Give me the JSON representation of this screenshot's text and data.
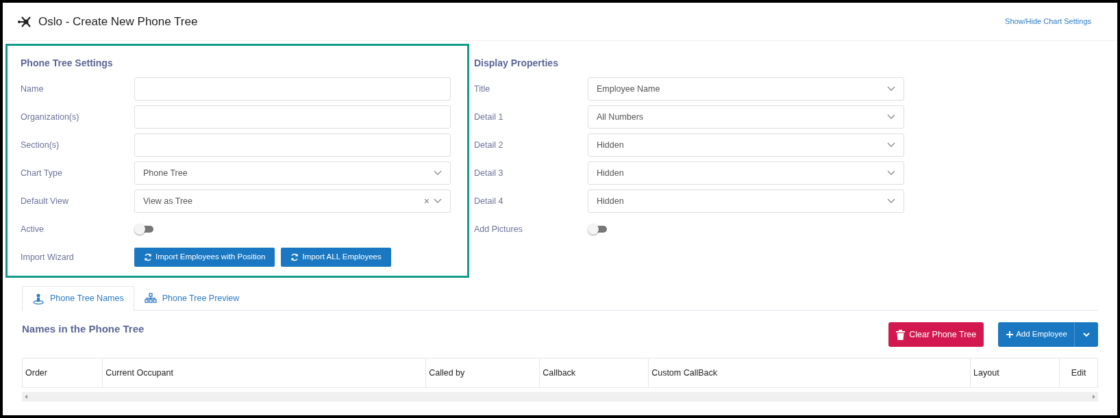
{
  "header": {
    "title": "Oslo - Create New Phone Tree",
    "link": "Show/Hide Chart Settings"
  },
  "settings": {
    "heading": "Phone Tree Settings",
    "fields": [
      {
        "label": "Name",
        "kind": "text"
      },
      {
        "label": "Organization(s)",
        "kind": "text"
      },
      {
        "label": "Section(s)",
        "kind": "text"
      },
      {
        "label": "Chart Type",
        "kind": "select",
        "value": "Phone Tree"
      },
      {
        "label": "Default View",
        "kind": "select",
        "value": "View as Tree",
        "clear_glyph": "×"
      },
      {
        "label": "Active",
        "kind": "toggle",
        "on": false
      },
      {
        "label": "Import Wizard",
        "kind": "buttons",
        "buttons": [
          "Import Employees with Position",
          "Import ALL Employees"
        ]
      }
    ]
  },
  "display": {
    "heading": "Display Properties",
    "fields": [
      {
        "label": "Title",
        "kind": "select",
        "value": "Employee Name"
      },
      {
        "label": "Detail 1",
        "kind": "select",
        "value": "All Numbers"
      },
      {
        "label": "Detail 2",
        "kind": "select",
        "value": "Hidden"
      },
      {
        "label": "Detail 3",
        "kind": "select",
        "value": "Hidden"
      },
      {
        "label": "Detail 4",
        "kind": "select",
        "value": "Hidden"
      },
      {
        "label": "Add Pictures",
        "kind": "toggle",
        "on": false
      }
    ]
  },
  "tabs": [
    {
      "label": "Phone Tree Names",
      "selected": true
    },
    {
      "label": "Phone Tree Preview",
      "selected": false
    }
  ],
  "names": {
    "heading": "Names in the Phone Tree",
    "clear_button": "Clear Phone Tree",
    "add_button": "Add Employee",
    "table": {
      "columns": [
        "Order",
        "Current Occupant",
        "Called by",
        "Callback",
        "Custom CallBack",
        "Layout",
        "Edit"
      ]
    }
  }
}
